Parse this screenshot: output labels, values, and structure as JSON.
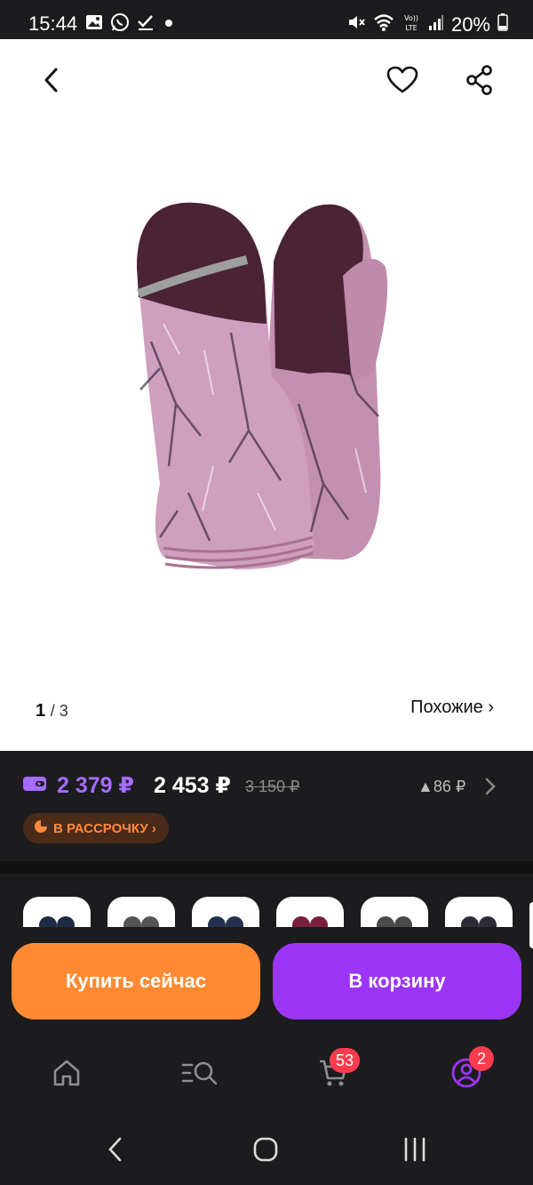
{
  "status_bar": {
    "time": "15:44",
    "battery": "20%",
    "left_icons": [
      "gallery-icon",
      "whatsapp-icon",
      "download-check-icon",
      "dot-icon"
    ],
    "right_icons": [
      "mute-icon",
      "wifi-icon",
      "volte-icon",
      "signal-icon",
      "battery-icon"
    ]
  },
  "product": {
    "image_counter": {
      "current": "1",
      "total": "3"
    },
    "similar_label": "Похожие ›"
  },
  "price": {
    "wallet_price": "2 379 ₽",
    "main_price": "2 453 ₽",
    "old_price": "3 150 ₽",
    "points": "▲86 ₽",
    "installment_label": "В РАССРОЧКУ ›"
  },
  "variants": [
    {
      "color": "#1f2a44"
    },
    {
      "color": "#555555"
    },
    {
      "color": "#24314e"
    },
    {
      "color": "#7a1f3d"
    },
    {
      "color": "#4a4a4a"
    },
    {
      "color": "#2b2b3a"
    }
  ],
  "actions": {
    "buy_now": "Купить сейчас",
    "add_to_cart": "В корзину"
  },
  "tab_bar": {
    "cart_badge": "53",
    "profile_badge": "2"
  },
  "colors": {
    "accent_purple": "#9b35f5",
    "accent_orange": "#ff8a33",
    "badge_red": "#ff3b4e",
    "wallet_price": "#a56cff"
  }
}
